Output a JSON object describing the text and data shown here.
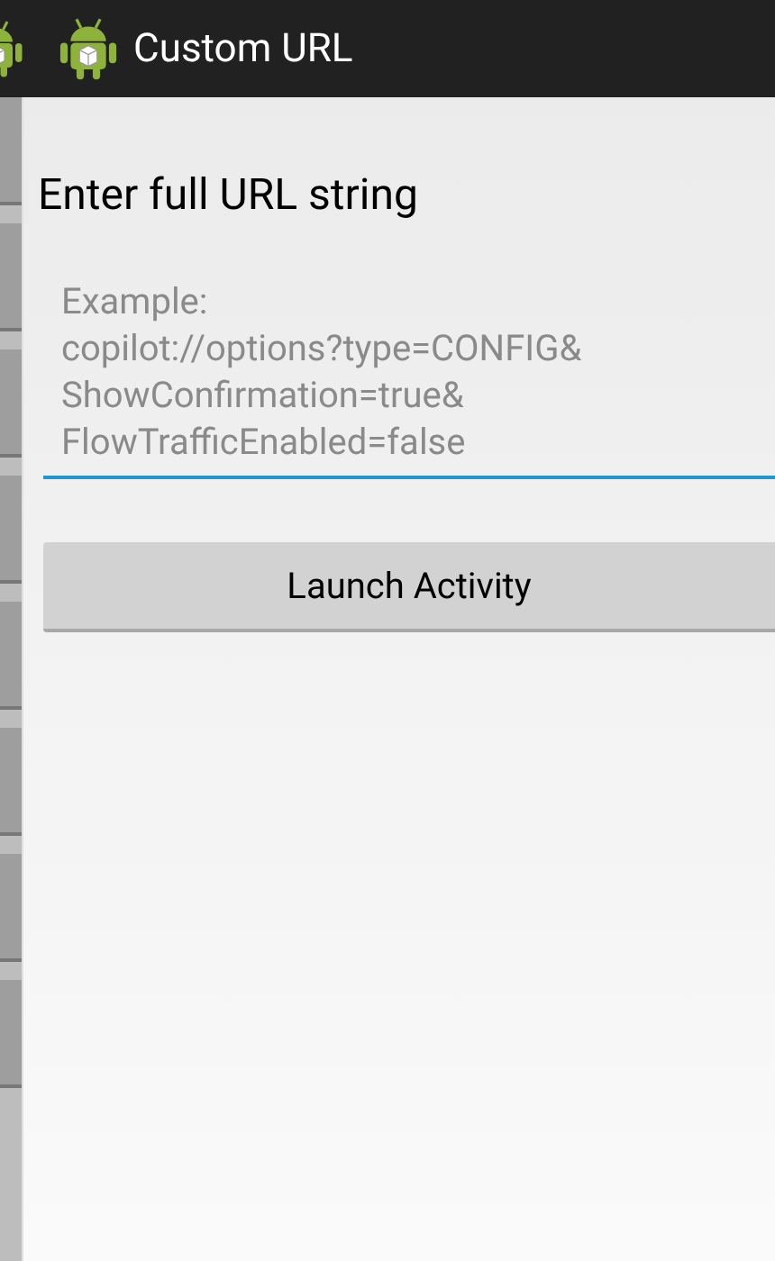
{
  "action_bar": {
    "title": "Custom URL"
  },
  "heading": "Enter full URL string",
  "url_field": {
    "placeholder": "Example:\ncopilot://options?type=CONFIG&\nShowConfirmation=true&\nFlowTrafficEnabled=false",
    "focused": true
  },
  "launch_button": {
    "label": "Launch Activity"
  }
}
